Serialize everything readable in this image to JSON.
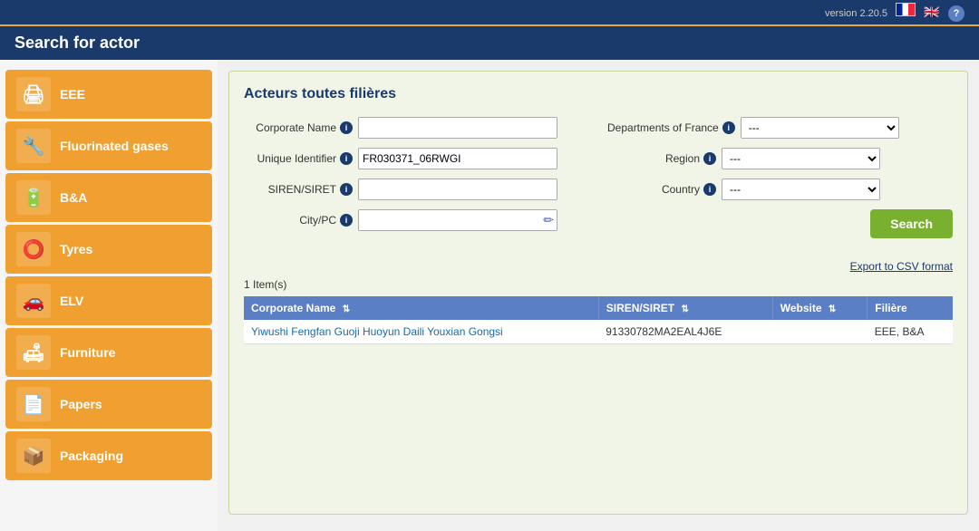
{
  "topbar": {
    "version": "version 2.20.5"
  },
  "header": {
    "title": "Search for actor"
  },
  "sidebar": {
    "items": [
      {
        "id": "eee",
        "label": "EEE",
        "icon": "🖨"
      },
      {
        "id": "fluorinated-gases",
        "label": "Fluorinated gases",
        "icon": "🔧"
      },
      {
        "id": "bna",
        "label": "B&A",
        "icon": "🔋"
      },
      {
        "id": "tyres",
        "label": "Tyres",
        "icon": "⭕"
      },
      {
        "id": "elv",
        "label": "ELV",
        "icon": "🚗"
      },
      {
        "id": "furniture",
        "label": "Furniture",
        "icon": "🛋"
      },
      {
        "id": "papers",
        "label": "Papers",
        "icon": "📄"
      },
      {
        "id": "packaging",
        "label": "Packaging",
        "icon": "📦"
      }
    ]
  },
  "form": {
    "section_title": "Acteurs toutes filières",
    "corporate_name_label": "Corporate Name",
    "unique_identifier_label": "Unique Identifier",
    "siren_siret_label": "SIREN/SIRET",
    "city_pc_label": "City/PC",
    "departments_label": "Departments of France",
    "region_label": "Region",
    "country_label": "Country",
    "unique_identifier_value": "FR030371_06RWGI",
    "corporate_name_value": "",
    "siren_siret_value": "",
    "city_pc_value": "",
    "dept_placeholder": "---",
    "region_placeholder": "---",
    "country_placeholder": "---",
    "search_button": "Search",
    "export_label": "Export to CSV format"
  },
  "results": {
    "count_label": "1 Item(s)",
    "columns": [
      {
        "id": "corporate_name",
        "label": "Corporate Name"
      },
      {
        "id": "siren_siret",
        "label": "SIREN/SIRET"
      },
      {
        "id": "website",
        "label": "Website"
      },
      {
        "id": "filiere",
        "label": "Filière"
      }
    ],
    "rows": [
      {
        "corporate_name": "Yiwushi Fengfan Guoji Huoyun Daili Youxian Gongsi",
        "siren_siret": "91330782MA2EAL4J6E",
        "website": "",
        "filiere": "EEE, B&A"
      }
    ]
  }
}
